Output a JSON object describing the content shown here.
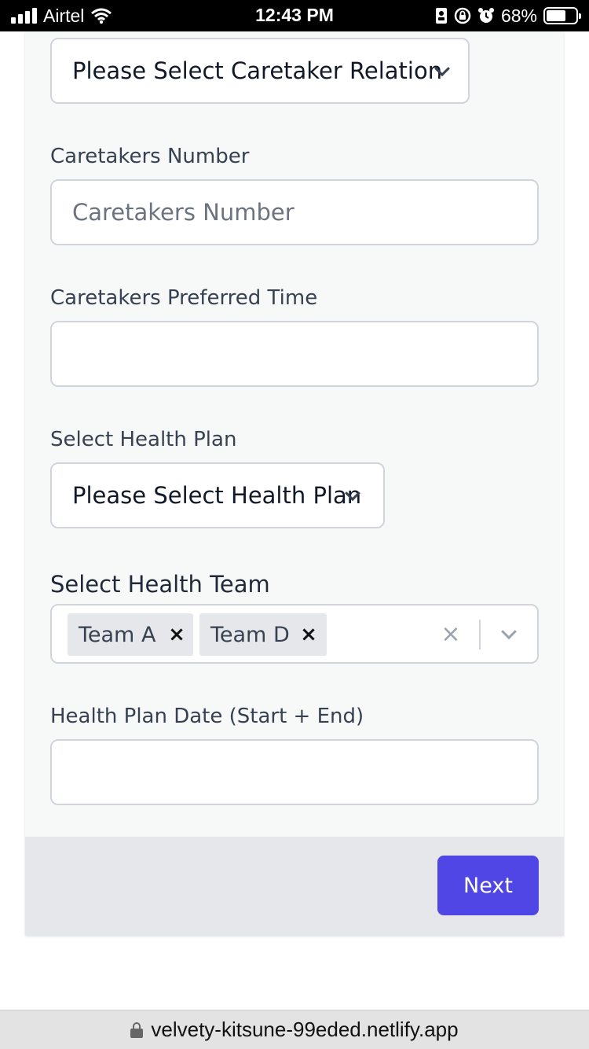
{
  "status_bar": {
    "carrier": "Airtel",
    "time": "12:43 PM",
    "battery": "68%",
    "battery_level": 0.68
  },
  "form": {
    "caretaker_relation": {
      "selected": "Please Select Caretaker Relation"
    },
    "caretakers_number": {
      "label": "Caretakers Number",
      "placeholder": "Caretakers Number",
      "value": ""
    },
    "caretakers_preferred_time": {
      "label": "Caretakers Preferred Time",
      "value": ""
    },
    "health_plan": {
      "label": "Select Health Plan",
      "selected": "Please Select Health Plan"
    },
    "health_team": {
      "label": "Select Health Team",
      "chips": [
        {
          "label": "Team A",
          "remove": "×"
        },
        {
          "label": "Team D",
          "remove": "×"
        }
      ],
      "clear": "×"
    },
    "health_plan_date": {
      "label": "Health Plan Date (Start + End)",
      "value": ""
    },
    "next_label": "Next"
  },
  "browser": {
    "url": "velvety-kitsune-99eded.netlify.app"
  },
  "colors": {
    "primary": "#4f46e5",
    "footer": "#e5e7eb",
    "card": "#f7f8f8"
  },
  "icons": [
    "signal-icon",
    "wifi-icon",
    "portrait-lock-icon",
    "orientation-lock-icon",
    "alarm-icon",
    "battery-icon",
    "chevron-down-icon",
    "close-icon",
    "lock-icon"
  ]
}
